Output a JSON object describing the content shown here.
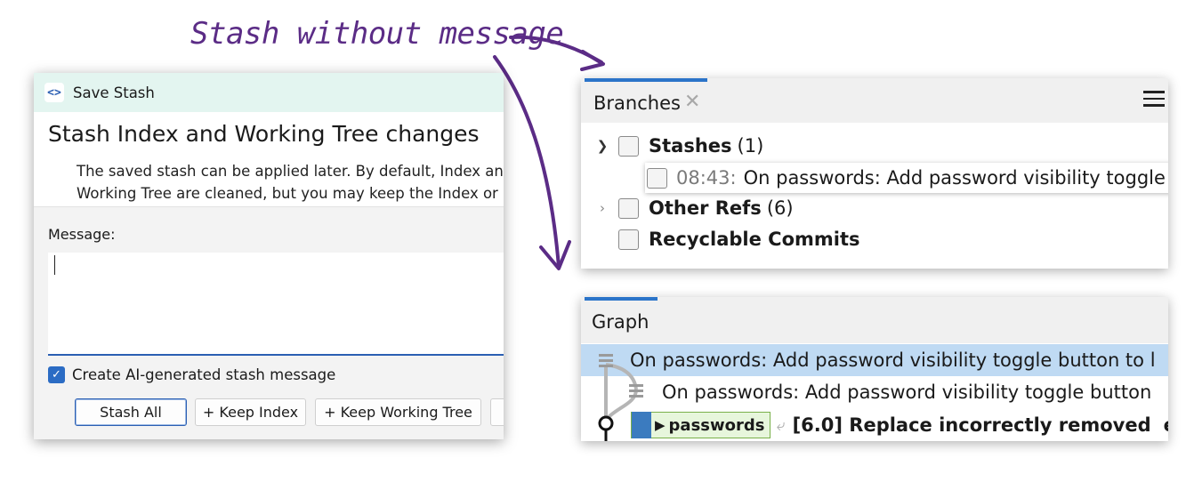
{
  "annotation": {
    "text": "Stash without message"
  },
  "dialog": {
    "icon": "<>",
    "title": "Save Stash",
    "heading": "Stash Index and Working Tree changes",
    "description_line1": "The saved stash can be applied later. By default, Index and",
    "description_line2": "Working Tree are cleaned, but you may keep the Index or",
    "message_label": "Message:",
    "message_value": "",
    "ai_checkbox_label": "Create AI-generated stash message",
    "ai_checkbox_checked": true,
    "buttons": {
      "stash_all": "Stash All",
      "keep_index": "+ Keep Index",
      "keep_working_tree": "+ Keep Working Tree"
    }
  },
  "branches": {
    "title": "Branches",
    "close_glyph": "✕",
    "items": [
      {
        "label": "Stashes",
        "count": "(1)",
        "expanded": true
      },
      {
        "time": "08:43:",
        "label": "On passwords: Add password visibility toggle"
      },
      {
        "label": "Other Refs",
        "count": "(6)",
        "expanded": false
      },
      {
        "label": "Recyclable Commits"
      }
    ]
  },
  "graph": {
    "title": "Graph",
    "rows": [
      {
        "text": "On passwords: Add password visibility toggle button to l",
        "selected": true
      },
      {
        "text": "On passwords: Add password visibility toggle button"
      },
      {
        "branch": "passwords",
        "text": "[6.0] Replace incorrectly removed",
        "tail": "er"
      }
    ]
  },
  "colors": {
    "annotation": "#5b2c86",
    "accent": "#2b74c9",
    "selected_row": "#bfdaf3",
    "dialog_titlebar": "#e3f5f0"
  }
}
